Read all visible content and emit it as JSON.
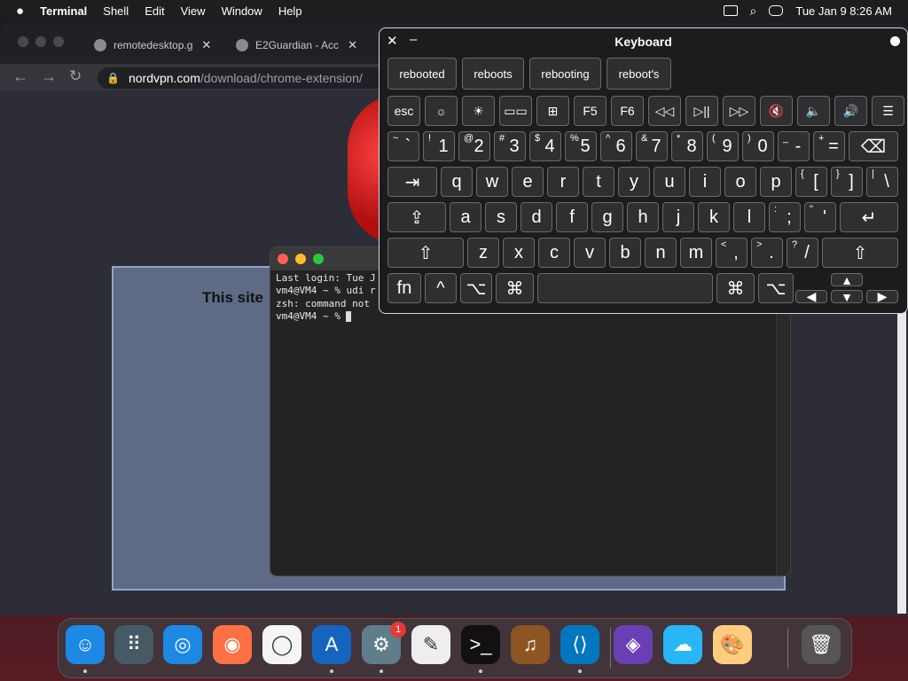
{
  "menubar": {
    "apple": "",
    "app": "Terminal",
    "items": [
      "Shell",
      "Edit",
      "View",
      "Window",
      "Help"
    ],
    "datetime": "Tue Jan 9  8:26 AM"
  },
  "browser": {
    "tabs": [
      {
        "label": "remotedesktop.g",
        "close": "✕"
      },
      {
        "label": "E2Guardian - Acc",
        "close": "✕"
      }
    ],
    "url_host": "nordvpn.com",
    "url_path": "/download/chrome-extension/",
    "block_text": "This site"
  },
  "terminal": {
    "lines": [
      "Last login: Tue J",
      "vm4@VM4 ~ % udi r",
      "zsh: command not",
      "vm4@VM4 ~ % "
    ]
  },
  "keyboard": {
    "title": "Keyboard",
    "close": "✕",
    "minimize": "–",
    "suggestions": [
      "rebooted",
      "reboots",
      "rebooting",
      "reboot's"
    ],
    "fn_row": [
      "esc",
      "☼",
      "☀",
      "▭▭",
      "⊞",
      "F5",
      "F6",
      "◁◁",
      "▷||",
      "▷▷",
      "🔇",
      "🔈",
      "🔊",
      "☰"
    ],
    "num_row": [
      {
        "s": "~",
        "m": "`"
      },
      {
        "s": "!",
        "m": "1"
      },
      {
        "s": "@",
        "m": "2"
      },
      {
        "s": "#",
        "m": "3"
      },
      {
        "s": "$",
        "m": "4"
      },
      {
        "s": "%",
        "m": "5"
      },
      {
        "s": "^",
        "m": "6"
      },
      {
        "s": "&",
        "m": "7"
      },
      {
        "s": "*",
        "m": "8"
      },
      {
        "s": "(",
        "m": "9"
      },
      {
        "s": ")",
        "m": "0"
      },
      {
        "s": "_",
        "m": "-"
      },
      {
        "s": "+",
        "m": "="
      }
    ],
    "delete": "⌫",
    "tab": "⇥",
    "q_row": [
      "q",
      "w",
      "e",
      "r",
      "t",
      "y",
      "u",
      "i",
      "o",
      "p"
    ],
    "bracket_keys": [
      {
        "s": "{",
        "m": "["
      },
      {
        "s": "}",
        "m": "]"
      },
      {
        "s": "|",
        "m": "\\"
      }
    ],
    "caps": "⇪",
    "a_row": [
      "a",
      "s",
      "d",
      "f",
      "g",
      "h",
      "j",
      "k",
      "l"
    ],
    "semi_keys": [
      {
        "s": ":",
        "m": ";"
      },
      {
        "s": "\"",
        "m": "'"
      }
    ],
    "return": "↵",
    "shift": "⇧",
    "z_row": [
      "z",
      "x",
      "c",
      "v",
      "b",
      "n",
      "m"
    ],
    "punct_keys": [
      {
        "s": "<",
        "m": ","
      },
      {
        "s": ">",
        "m": "."
      },
      {
        "s": "?",
        "m": "/"
      }
    ],
    "bottom": {
      "fn": "fn",
      "ctrl": "^",
      "opt": "⌥",
      "cmd": "⌘",
      "up": "▲",
      "down": "▼",
      "left": "◀",
      "right": "▶"
    }
  },
  "dock": {
    "apps": [
      "Finder",
      "Launchpad",
      "Safari",
      "Firefox",
      "Chrome",
      "App Store",
      "System Settings",
      "TextEdit",
      "Terminal",
      "GarageBand",
      "VS Code",
      "Visual Studio",
      "Weather",
      "Paintbrush",
      "Trash"
    ],
    "settings_badge": "1"
  },
  "colors": {
    "accent": "#8fa6c8",
    "badge": "#e53935"
  }
}
